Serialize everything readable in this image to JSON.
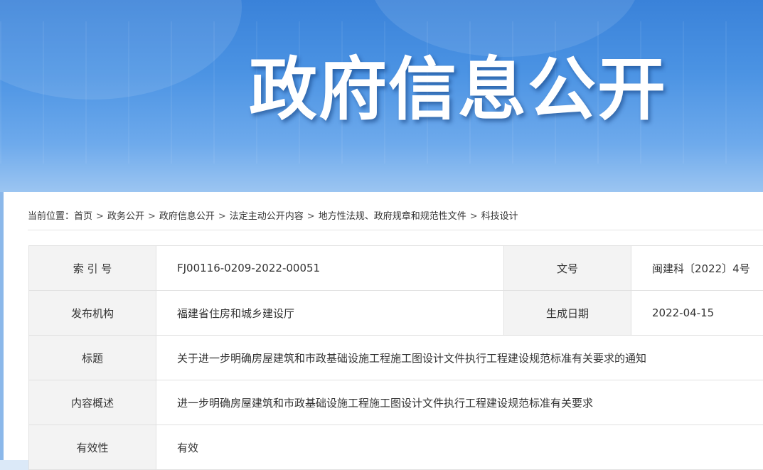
{
  "banner": {
    "title": "政府信息公开"
  },
  "breadcrumb": {
    "prefix": "当前位置：",
    "items": [
      "首页",
      "政务公开",
      "政府信息公开",
      "法定主动公开内容",
      "地方性法规、政府规章和规范性文件",
      "科技设计"
    ],
    "separator": ">"
  },
  "info": {
    "index_label": "索 引 号",
    "index_value": "FJ00116-0209-2022-00051",
    "docno_label": "文号",
    "docno_value": "闽建科〔2022〕4号",
    "publisher_label": "发布机构",
    "publisher_value": "福建省住房和城乡建设厅",
    "date_label": "生成日期",
    "date_value": "2022-04-15",
    "title_label": "标题",
    "title_value": "关于进一步明确房屋建筑和市政基础设施工程施工图设计文件执行工程建设规范标准有关要求的通知",
    "summary_label": "内容概述",
    "summary_value": "进一步明确房屋建筑和市政基础设施工程施工图设计文件执行工程建设规范标准有关要求",
    "validity_label": "有效性",
    "validity_value": "有效"
  }
}
